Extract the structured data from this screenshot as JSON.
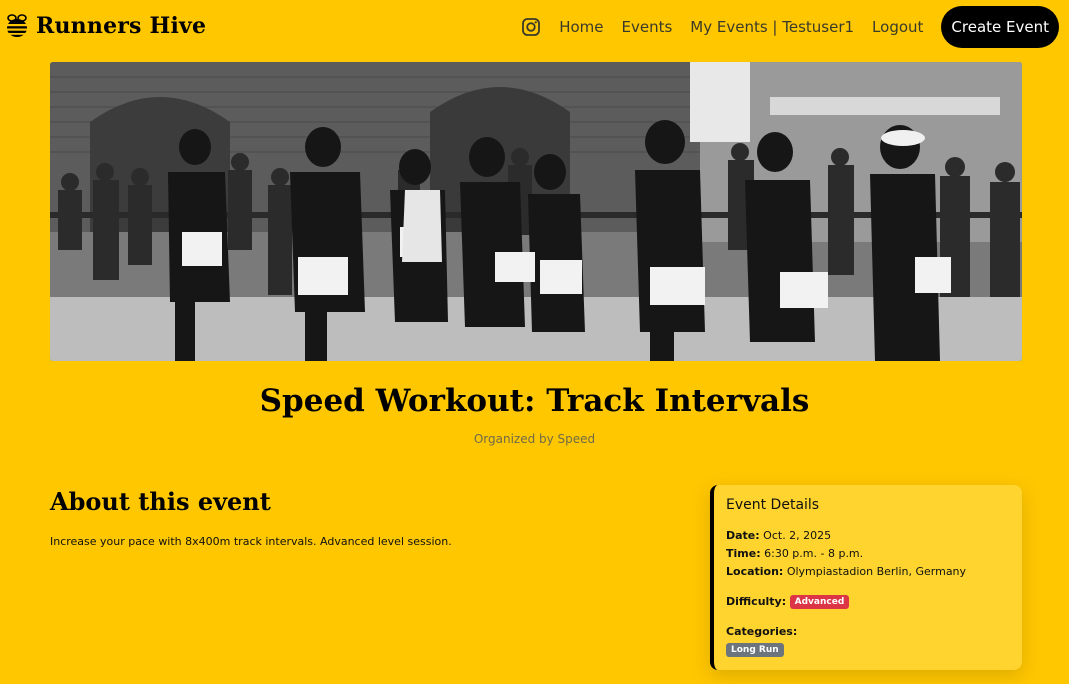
{
  "brand": {
    "name": "Runners Hive",
    "logo_icon": "bee-icon"
  },
  "nav": {
    "instagram_icon": "instagram-icon",
    "links": [
      {
        "label": "Home"
      },
      {
        "label": "Events"
      },
      {
        "label": "My Events | Testuser1"
      },
      {
        "label": "Logout"
      }
    ],
    "create_button": "Create Event"
  },
  "event": {
    "title": "Speed Workout: Track Intervals",
    "organizer": "Organized by Speed",
    "about_heading": "About this event",
    "description": "Increase your pace with 8x400m track intervals. Advanced level session."
  },
  "details": {
    "title": "Event Details",
    "date_label": "Date:",
    "date_value": "Oct. 2, 2025",
    "time_label": "Time:",
    "time_value": "6:30 p.m. - 8 p.m.",
    "location_label": "Location:",
    "location_value": "Olympiastadion Berlin, Germany",
    "difficulty_label": "Difficulty:",
    "difficulty_value": "Advanced",
    "categories_label": "Categories:",
    "categories": [
      "Long Run"
    ]
  },
  "colors": {
    "background": "#ffc700",
    "card": "#ffd42e",
    "button": "#000000",
    "badge_danger": "#dc3545",
    "badge_secondary": "#6c757d"
  }
}
